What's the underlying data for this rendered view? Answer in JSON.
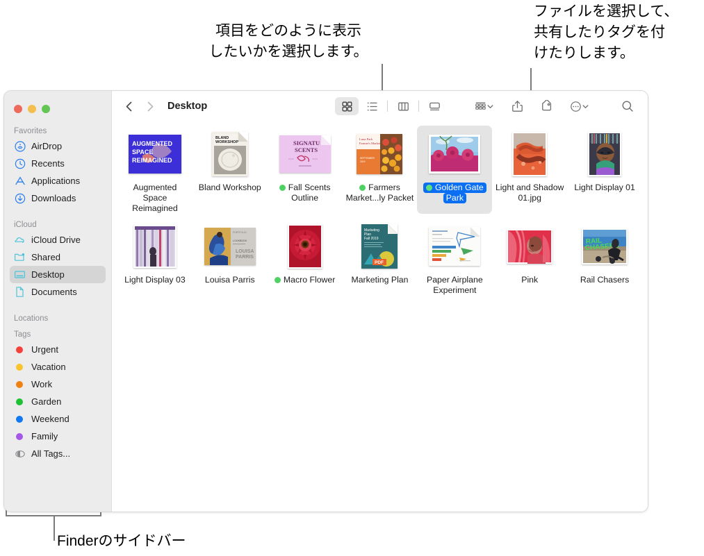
{
  "annotations": {
    "view_options": "項目をどのように表示\nしたいかを選択します。",
    "share_tag": "ファイルを選択して、\n共有したりタグを付\nけたりします。",
    "sidebar": "Finderのサイドバー"
  },
  "window": {
    "title": "Desktop",
    "traffic_lights": [
      "close",
      "minimize",
      "zoom"
    ]
  },
  "toolbar": {
    "back_label": "Back",
    "forward_label": "Forward",
    "path_title": "Desktop",
    "view_modes": [
      {
        "name": "icon-view",
        "label": "As Icons",
        "active": true
      },
      {
        "name": "list-view",
        "label": "As List",
        "active": false
      },
      {
        "name": "column-view",
        "label": "As Columns",
        "active": false
      },
      {
        "name": "gallery-view",
        "label": "As Gallery",
        "active": false
      }
    ],
    "group_label": "Group",
    "share_label": "Share",
    "tag_label": "Tags",
    "more_label": "More",
    "search_label": "Search"
  },
  "sidebar": {
    "sections": [
      {
        "title": "Favorites",
        "items": [
          {
            "label": "AirDrop",
            "icon": "airdrop-icon",
            "color": "#2a7ef0",
            "selected": false
          },
          {
            "label": "Recents",
            "icon": "clock-icon",
            "color": "#2a7ef0",
            "selected": false
          },
          {
            "label": "Applications",
            "icon": "applications-icon",
            "color": "#2a7ef0",
            "selected": false
          },
          {
            "label": "Downloads",
            "icon": "downloads-icon",
            "color": "#2a7ef0",
            "selected": false
          }
        ]
      },
      {
        "title": "iCloud",
        "items": [
          {
            "label": "iCloud Drive",
            "icon": "cloud-icon",
            "color": "#4cc3d9",
            "selected": false
          },
          {
            "label": "Shared",
            "icon": "shared-folder-icon",
            "color": "#4cc3d9",
            "selected": false
          },
          {
            "label": "Desktop",
            "icon": "desktop-icon",
            "color": "#4cc3d9",
            "selected": true
          },
          {
            "label": "Documents",
            "icon": "document-icon",
            "color": "#4cc3d9",
            "selected": false
          }
        ]
      },
      {
        "title": "Locations",
        "items": []
      },
      {
        "title": "Tags",
        "items": [
          {
            "label": "Urgent",
            "icon": "tag-dot",
            "color": "#f6403c",
            "selected": false
          },
          {
            "label": "Vacation",
            "icon": "tag-dot",
            "color": "#f8c32c",
            "selected": false
          },
          {
            "label": "Work",
            "icon": "tag-dot",
            "color": "#f08011",
            "selected": false
          },
          {
            "label": "Garden",
            "icon": "tag-dot",
            "color": "#1cc234",
            "selected": false
          },
          {
            "label": "Weekend",
            "icon": "tag-dot",
            "color": "#1177f2",
            "selected": false
          },
          {
            "label": "Family",
            "icon": "tag-dot",
            "color": "#a557e8",
            "selected": false
          },
          {
            "label": "All Tags...",
            "icon": "all-tags-icon",
            "color": "#888888",
            "selected": false
          }
        ]
      }
    ]
  },
  "files": [
    {
      "name": "Augmented\nSpace Reimagined",
      "kind": "image",
      "tag": null,
      "selected": false
    },
    {
      "name": "Bland Workshop",
      "kind": "document",
      "tag": null,
      "selected": false
    },
    {
      "name": "Fall Scents\nOutline",
      "kind": "document",
      "tag": "#4fd263",
      "selected": false
    },
    {
      "name": "Farmers\nMarket...ly Packet",
      "kind": "document",
      "tag": "#4fd263",
      "selected": false
    },
    {
      "name": "Golden Gate\nPark",
      "kind": "photo",
      "tag": "#4fd263",
      "selected": true
    },
    {
      "name": "Light and Shadow\n01.jpg",
      "kind": "photo",
      "tag": null,
      "selected": false
    },
    {
      "name": "Light Display 01",
      "kind": "photo",
      "tag": null,
      "selected": false
    },
    {
      "name": "Light Display 03",
      "kind": "photo",
      "tag": null,
      "selected": false
    },
    {
      "name": "Louisa Parris",
      "kind": "image",
      "tag": null,
      "selected": false
    },
    {
      "name": "Macro Flower",
      "kind": "photo",
      "tag": "#4fd263",
      "selected": false
    },
    {
      "name": "Marketing Plan",
      "kind": "pdf",
      "tag": null,
      "selected": false
    },
    {
      "name": "Paper Airplane\nExperiment",
      "kind": "document",
      "tag": null,
      "selected": false
    },
    {
      "name": "Pink",
      "kind": "photo",
      "tag": null,
      "selected": false
    },
    {
      "name": "Rail Chasers",
      "kind": "photo",
      "tag": null,
      "selected": false
    }
  ],
  "colors": {
    "selection_blue": "#0a6ff2",
    "sidebar_bg": "#ececec",
    "accent_blue": "#2a7ef0",
    "icloud_teal": "#4cc3d9"
  }
}
